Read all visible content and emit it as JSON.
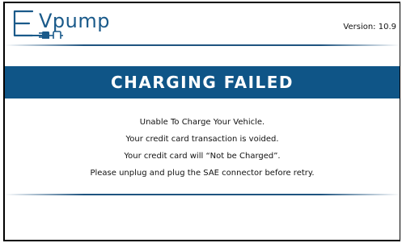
{
  "header": {
    "logo": {
      "name": "EVpump",
      "prefix": "E",
      "word": "Vpump",
      "icon": "plug-connector-icon"
    },
    "version": "Version: 10.9"
  },
  "banner": {
    "title": "CHARGING FAILED"
  },
  "messages": [
    "Unable To Charge Your Vehicle.",
    "Your credit card transaction is voided.",
    "Your credit card will “Not be Charged”.",
    "Please unplug and plug the SAE connector before retry."
  ],
  "colors": {
    "brand": "#1a5a8a",
    "banner": "#0f5587",
    "divider": "#1f5480"
  }
}
